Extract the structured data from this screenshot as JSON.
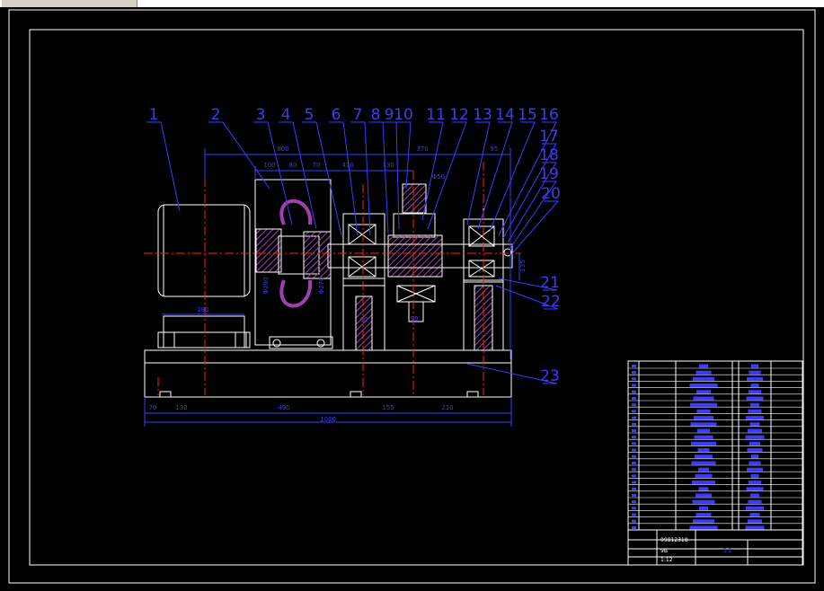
{
  "window": {
    "topbar": ""
  },
  "colors": {
    "background": "#000000",
    "frame": "#ffffff",
    "outline": "#ffffff",
    "dimension": "#3b3bff",
    "centerline": "#ff2020",
    "hatch": "#a040b0",
    "leader": "#3b3bff",
    "bearing": "#ffffff"
  },
  "part_numbers": [
    "1",
    "2",
    "3",
    "4",
    "5",
    "6",
    "7",
    "8",
    "9",
    "10",
    "11",
    "12",
    "13",
    "14",
    "15",
    "16",
    "17",
    "18",
    "19",
    "20",
    "21",
    "22",
    "23"
  ],
  "dimensions": {
    "top_overall": "800",
    "top_right": "370",
    "top_far_right": "95",
    "top_row2": [
      "100",
      "80",
      "70",
      "410",
      "130"
    ],
    "shaft_dia": "Φ50",
    "coupling_dia_1": "Φ200",
    "coupling_dia_2": "Φ270",
    "motor_base": "280",
    "bottom_row": [
      "70",
      "130",
      "490",
      "155",
      "210"
    ],
    "bottom_overall": "1030",
    "side_right": "135",
    "support_1": "90",
    "support_2": "90"
  },
  "title_block": {
    "rows_left": [
      "",
      "",
      "",
      ""
    ],
    "value_1": "09812318",
    "value_2": "9B",
    "value_3": "1:12",
    "name": "",
    "scale": "1:1"
  }
}
